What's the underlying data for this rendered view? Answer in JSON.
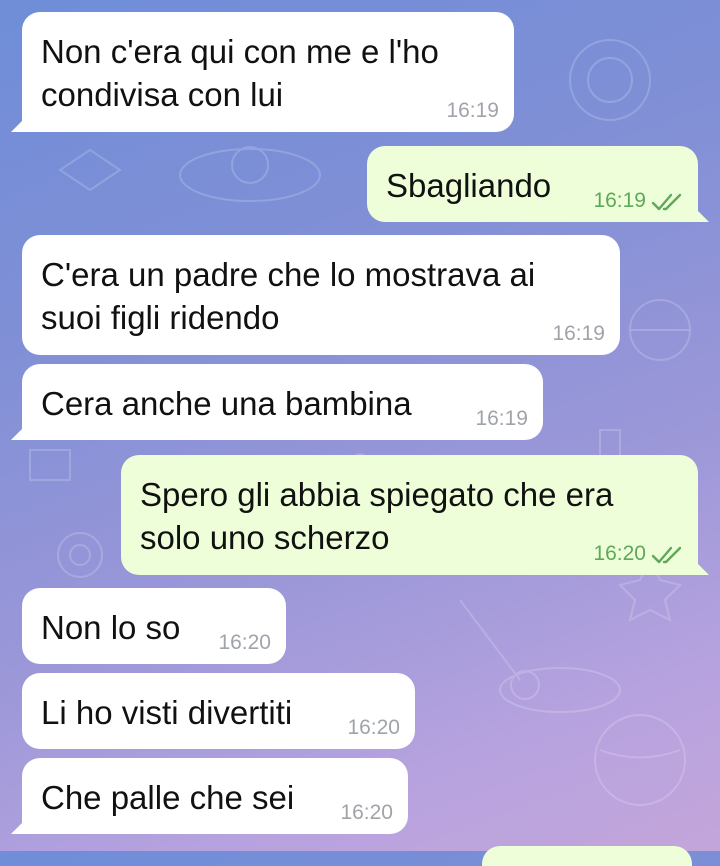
{
  "messages": [
    {
      "text": "Non c'era qui con me e l'ho\ncondivisa con lui",
      "time": "16:19",
      "direction": "incoming"
    },
    {
      "text": "Sbagliando",
      "time": "16:19",
      "direction": "outgoing",
      "status": "read"
    },
    {
      "text": "C'era un padre che lo mostrava ai\nsuoi figli ridendo",
      "time": "16:19",
      "direction": "incoming"
    },
    {
      "text": "Cera anche una bambina",
      "time": "16:19",
      "direction": "incoming"
    },
    {
      "text": "Spero gli abbia spiegato che era\nsolo uno scherzo",
      "time": "16:20",
      "direction": "outgoing",
      "status": "read"
    },
    {
      "text": "Non lo so",
      "time": "16:20",
      "direction": "incoming"
    },
    {
      "text": "Li ho visti divertiti",
      "time": "16:20",
      "direction": "incoming"
    },
    {
      "text": "Che palle che sei",
      "time": "16:20",
      "direction": "incoming"
    }
  ],
  "colors": {
    "incoming_bubble": "#ffffff",
    "outgoing_bubble": "#eefed9",
    "outgoing_time": "#5fa85a",
    "incoming_time": "#a0a4aa",
    "read_check": "#5fa85a"
  },
  "icons": {
    "read_status": "double-check-icon",
    "background": "space-doodle-pattern"
  }
}
